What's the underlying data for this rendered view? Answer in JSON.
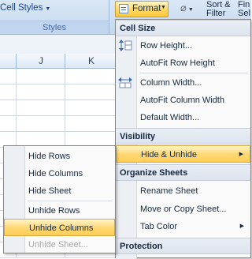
{
  "ribbon": {
    "cell_styles_label": "Cell Styles",
    "styles_group_label": "Styles",
    "format_button_label": "Format",
    "sort_filter_label": "Sort &\nFilter",
    "find_select_label": "Fin\nSel"
  },
  "grid": {
    "columns": [
      "J",
      "K"
    ]
  },
  "format_menu": {
    "cell_size_header": "Cell Size",
    "items_cell_size": [
      "Row Height...",
      "AutoFit Row Height",
      "Column Width...",
      "AutoFit Column Width",
      "Default Width..."
    ],
    "visibility_header": "Visibility",
    "hide_unhide_label": "Hide & Unhide",
    "organize_header": "Organize Sheets",
    "items_organize": [
      "Rename Sheet",
      "Move or Copy Sheet...",
      "Tab Color"
    ],
    "protection_header": "Protection"
  },
  "hide_unhide_menu": {
    "items": [
      "Hide Rows",
      "Hide Columns",
      "Hide Sheet",
      "Unhide Rows",
      "Unhide Columns",
      "Unhide Sheet..."
    ],
    "highlighted": "Unhide Columns",
    "disabled": "Unhide Sheet..."
  },
  "colors": {
    "highlight": "#ffd977",
    "ribbon": "#c4d8ee"
  }
}
